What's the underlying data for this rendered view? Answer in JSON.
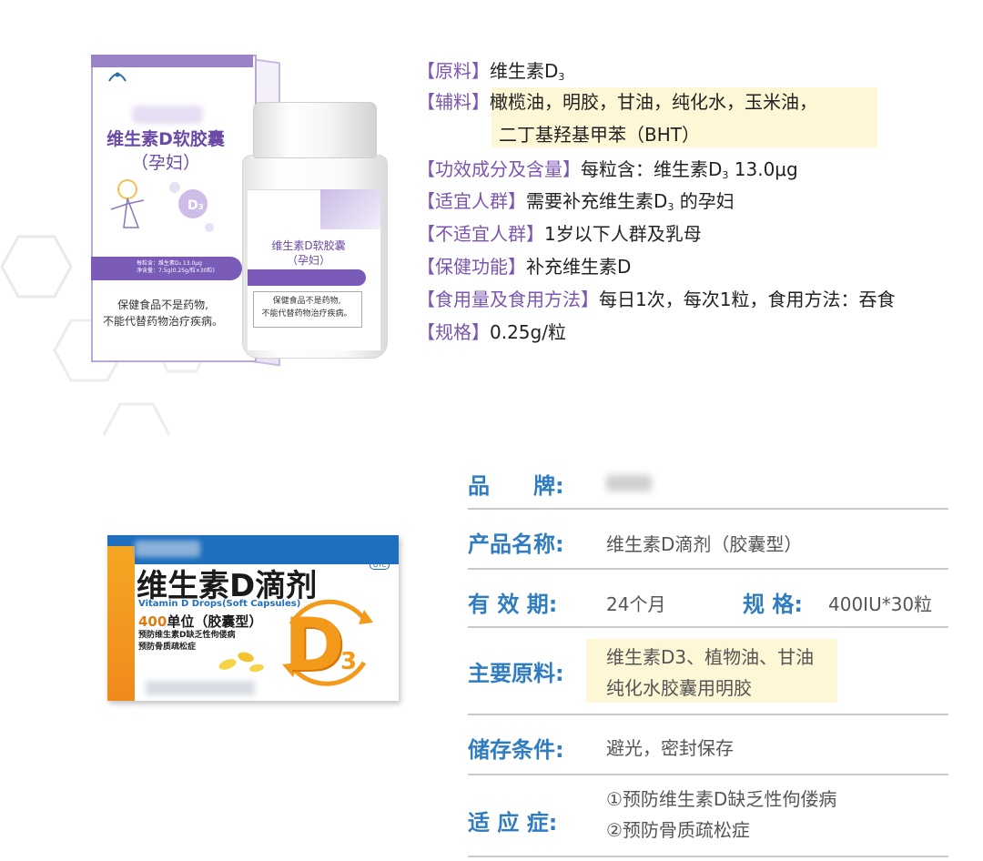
{
  "product1": {
    "box_title": "维生素D软胶囊",
    "box_subtitle": "（孕妇）",
    "box_warning_1": "保健食品不是药物,",
    "box_warning_2": "不能代替药物治疗疾病。",
    "bottle_title_1": "维生素D软胶囊",
    "bottle_title_2": "（孕妇）",
    "bottle_warning_1": "保健食品不是药物,",
    "bottle_warning_2": "不能代替药物治疗疾病。",
    "band_line_1": "每粒含：维生素D₃ 13.0μg",
    "band_line_2": "净含量：7.5g(0.25g/粒×30粒)"
  },
  "spec_list": [
    {
      "key": "【原料】",
      "value": "维生素D",
      "sub": "3"
    },
    {
      "key": "【辅料】",
      "value": "橄榄油，明胶，甘油，纯化水，玉米油，"
    },
    {
      "key": "",
      "value": "二丁基羟基甲苯（BHT）"
    },
    {
      "key": "【功效成分及含量】",
      "value": "每粒含：维生素D",
      "sub": "3",
      "value_after": " 13.0μg"
    },
    {
      "key": "【适宜人群】",
      "value": "需要补充维生素D",
      "sub": "3",
      "value_after": " 的孕妇"
    },
    {
      "key": "【不适宜人群】",
      "value": "1岁以下人群及乳母"
    },
    {
      "key": "【保健功能】",
      "value": "补充维生素D"
    },
    {
      "key": "【食用量及食用方法】",
      "value": "每日1次，每次1粒，食用方法：吞食"
    },
    {
      "key": "【规格】",
      "value": "0.25g/粒"
    }
  ],
  "product2": {
    "title": "维生素D滴剂",
    "english": "Vitamin D Drops(Soft Capsules)",
    "unit_num": "400",
    "unit_text": "单位（胶囊型）",
    "indication_1": "预防维生素D缺乏性佝偻病",
    "indication_2": "预防骨质疏松症",
    "otc": "OTC",
    "d_letter": "D",
    "d_sub": "3"
  },
  "table": {
    "brand_label": "品　　牌:",
    "name_label": "产品名称:",
    "name_value": "维生素D滴剂（胶囊型）",
    "expiry_label": "有 效 期:",
    "expiry_value": "24个月",
    "spec_label": "规 格:",
    "spec_value": "400IU*30粒",
    "ingredient_label": "主要原料:",
    "ingredient_value_1": "维生素D3、植物油、甘油",
    "ingredient_value_2": "纯化水胶囊用明胶",
    "storage_label": "储存条件:",
    "storage_value": "避光，密封保存",
    "indication_label": "适 应 症:",
    "indication_value_1": "①预防维生素D缺乏性佝偻病",
    "indication_value_2": "②预防骨质疏松症"
  },
  "colors": {
    "spec_key": "#7b55b0",
    "table_key": "#2f7cc1",
    "highlight": "#fdf7d6",
    "brand_purple": "#7a5cb8",
    "d3_orange": "#f39a1b"
  }
}
